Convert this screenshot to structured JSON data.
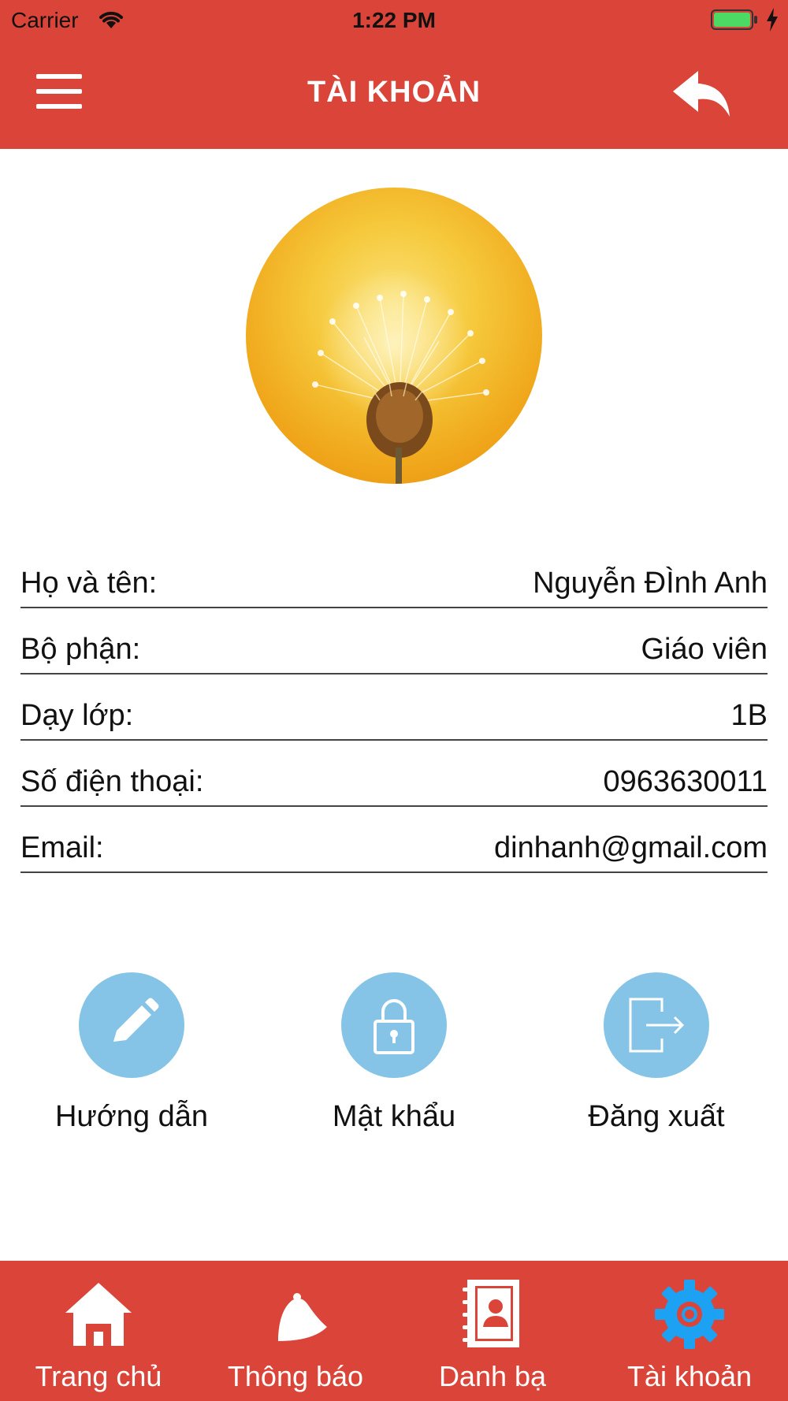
{
  "status_bar": {
    "carrier": "Carrier",
    "time": "1:22 PM",
    "wifi_icon": "wifi-icon",
    "battery_icon": "battery-icon",
    "battery_color": "#4cd964"
  },
  "header": {
    "title": "TÀI KHOẢN",
    "menu_icon": "hamburger-menu-icon",
    "back_icon": "reply-arrow-icon",
    "background": "#db4438"
  },
  "avatar": {
    "description_icon": "dandelion-avatar-image"
  },
  "profile": {
    "rows": [
      {
        "label": "Họ và tên:",
        "value": "Nguyễn ĐÌnh Anh"
      },
      {
        "label": "Bộ phận:",
        "value": "Giáo viên"
      },
      {
        "label": "Dạy lớp:",
        "value": "1B"
      },
      {
        "label": "Số điện thoại:",
        "value": "0963630011"
      },
      {
        "label": "Email:",
        "value": "dinhanh@gmail.com"
      }
    ]
  },
  "actions": [
    {
      "label": "Hướng dẫn",
      "icon": "pencil-icon"
    },
    {
      "label": "Mật khẩu",
      "icon": "lock-icon"
    },
    {
      "label": "Đăng xuất",
      "icon": "logout-icon"
    }
  ],
  "action_color": "#85c4e6",
  "tabbar": {
    "active_color": "#1da1f2",
    "tabs": [
      {
        "label": "Trang chủ",
        "icon": "home-icon"
      },
      {
        "label": "Thông báo",
        "icon": "bell-icon"
      },
      {
        "label": "Danh bạ",
        "icon": "contacts-book-icon"
      },
      {
        "label": "Tài khoản",
        "icon": "gear-icon",
        "active": true
      }
    ]
  }
}
